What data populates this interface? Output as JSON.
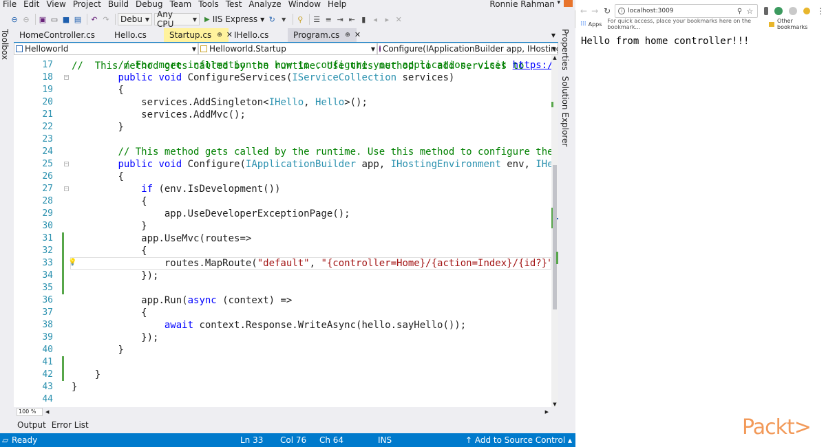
{
  "menu": {
    "items": [
      "File",
      "Edit",
      "View",
      "Project",
      "Build",
      "Debug",
      "Team",
      "Tools",
      "Test",
      "Analyze",
      "Window",
      "Help"
    ],
    "user_name": "Ronnie Rahman"
  },
  "toolbar": {
    "config": "Debu",
    "platform": "Any CPU",
    "start_label": "IIS Express"
  },
  "toolbox_label": "Toolbox",
  "side_panels": [
    "Properties",
    "Solution Explorer"
  ],
  "tabs": [
    {
      "label": "HomeController.cs"
    },
    {
      "label": "Hello.cs"
    },
    {
      "label": "Startup.cs",
      "pin": "⊕",
      "close": "✕"
    },
    {
      "label": "IHello.cs"
    },
    {
      "label": "Program.cs",
      "pin": "⊕",
      "close": "✕"
    }
  ],
  "navbar": {
    "project": "Helloworld",
    "class": "Helloworld.Startup",
    "member": "Configure(IApplicationBuilder app, IHostingEn"
  },
  "editor": {
    "top_partial": "//  This method gets called by the runtime. Use this method to add services to",
    "lines": [
      {
        "n": "17",
        "indent": "        ",
        "tokens": [
          [
            "cm",
            "// For more information on how to configure your application, visit "
          ],
          [
            "lnk",
            "https://go"
          ]
        ]
      },
      {
        "n": "18",
        "indent": "        ",
        "tokens": [
          [
            "kw",
            "public"
          ],
          [
            "pl",
            " "
          ],
          [
            "kw",
            "void"
          ],
          [
            "pl",
            " ConfigureServices("
          ],
          [
            "ty",
            "IServiceCollection"
          ],
          [
            "pl",
            " services)"
          ]
        ]
      },
      {
        "n": "19",
        "indent": "        ",
        "tokens": [
          [
            "pl",
            "{"
          ]
        ]
      },
      {
        "n": "20",
        "indent": "            ",
        "tokens": [
          [
            "pl",
            "services.AddSingleton<"
          ],
          [
            "ty",
            "IHello"
          ],
          [
            "pl",
            ", "
          ],
          [
            "ty",
            "Hello"
          ],
          [
            "pl",
            ">();"
          ]
        ]
      },
      {
        "n": "21",
        "indent": "            ",
        "tokens": [
          [
            "pl",
            "services.AddMvc();"
          ]
        ]
      },
      {
        "n": "22",
        "indent": "        ",
        "tokens": [
          [
            "pl",
            "}"
          ]
        ]
      },
      {
        "n": "23",
        "indent": "",
        "tokens": []
      },
      {
        "n": "24",
        "indent": "        ",
        "tokens": [
          [
            "cm",
            "// This method gets called by the runtime. Use this method to configure the HT"
          ]
        ]
      },
      {
        "n": "25",
        "indent": "        ",
        "tokens": [
          [
            "kw",
            "public"
          ],
          [
            "pl",
            " "
          ],
          [
            "kw",
            "void"
          ],
          [
            "pl",
            " Configure("
          ],
          [
            "ty",
            "IApplicationBuilder"
          ],
          [
            "pl",
            " app, "
          ],
          [
            "ty",
            "IHostingEnvironment"
          ],
          [
            "pl",
            " env, "
          ],
          [
            "ty",
            "IHello"
          ]
        ]
      },
      {
        "n": "26",
        "indent": "        ",
        "tokens": [
          [
            "pl",
            "{"
          ]
        ]
      },
      {
        "n": "27",
        "indent": "            ",
        "tokens": [
          [
            "kw",
            "if"
          ],
          [
            "pl",
            " (env.IsDevelopment())"
          ]
        ]
      },
      {
        "n": "28",
        "indent": "            ",
        "tokens": [
          [
            "pl",
            "{"
          ]
        ]
      },
      {
        "n": "29",
        "indent": "                ",
        "tokens": [
          [
            "pl",
            "app.UseDeveloperExceptionPage();"
          ]
        ]
      },
      {
        "n": "30",
        "indent": "            ",
        "tokens": [
          [
            "pl",
            "}"
          ]
        ]
      },
      {
        "n": "31",
        "indent": "            ",
        "tokens": [
          [
            "pl",
            "app.UseMvc(routes=>"
          ]
        ]
      },
      {
        "n": "32",
        "indent": "            ",
        "tokens": [
          [
            "pl",
            "{"
          ]
        ]
      },
      {
        "n": "33",
        "indent": "                ",
        "tokens": [
          [
            "pl",
            "routes.MapRoute("
          ],
          [
            "st",
            "\"default\""
          ],
          [
            "pl",
            ", "
          ],
          [
            "st",
            "\"{controller=Home}/{action=Index}/{id?}\""
          ],
          [
            "pl",
            ");"
          ]
        ]
      },
      {
        "n": "34",
        "indent": "            ",
        "tokens": [
          [
            "pl",
            "});"
          ]
        ]
      },
      {
        "n": "35",
        "indent": "",
        "tokens": []
      },
      {
        "n": "36",
        "indent": "            ",
        "tokens": [
          [
            "pl",
            "app.Run("
          ],
          [
            "kw",
            "async"
          ],
          [
            "pl",
            " (context) =>"
          ]
        ]
      },
      {
        "n": "37",
        "indent": "            ",
        "tokens": [
          [
            "pl",
            "{"
          ]
        ]
      },
      {
        "n": "38",
        "indent": "                ",
        "tokens": [
          [
            "kw",
            "await"
          ],
          [
            "pl",
            " context.Response.WriteAsync(hello.sayHello());"
          ]
        ]
      },
      {
        "n": "39",
        "indent": "            ",
        "tokens": [
          [
            "pl",
            "});"
          ]
        ]
      },
      {
        "n": "40",
        "indent": "        ",
        "tokens": [
          [
            "pl",
            "}"
          ]
        ]
      },
      {
        "n": "41",
        "indent": "",
        "tokens": []
      },
      {
        "n": "42",
        "indent": "    ",
        "tokens": [
          [
            "pl",
            "}"
          ]
        ]
      },
      {
        "n": "43",
        "indent": "",
        "tokens": [
          [
            "pl",
            "}"
          ]
        ]
      },
      {
        "n": "44",
        "indent": "",
        "tokens": []
      }
    ]
  },
  "zoom": "100 %",
  "output_tabs": [
    "Output",
    "Error List"
  ],
  "status": {
    "ready": "Ready",
    "line": "Ln 33",
    "col": "Col 76",
    "ch": "Ch 64",
    "mode": "INS",
    "source_control": "↑ Add to Source Control ▴"
  },
  "browser": {
    "url": "localhost:3009",
    "bookmarks_apps": "Apps",
    "bookmarks_hint": "For quick access, place your bookmarks here on the bookmark...",
    "other_bookmarks": "Other bookmarks",
    "page_text": "Hello from home controller!!!"
  },
  "watermark": "Packt>",
  "colors": {
    "status_bar": "#007acc",
    "active_tab": "#fff29d",
    "comment": "#008000",
    "keyword": "#0000ff",
    "type": "#2b91af",
    "string": "#a31515"
  }
}
